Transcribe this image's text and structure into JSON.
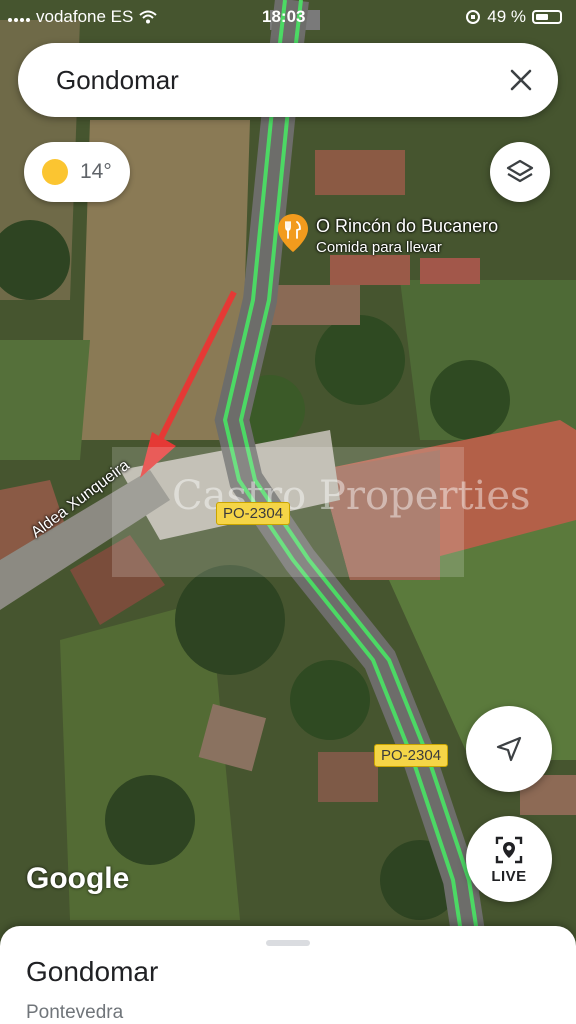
{
  "status_bar": {
    "carrier": "vodafone ES",
    "time": "18:03",
    "battery": "49 %"
  },
  "search": {
    "query": "Gondomar",
    "clear_icon": "close-icon"
  },
  "weather": {
    "temperature": "14°",
    "icon": "sun-icon"
  },
  "map": {
    "place": {
      "name": "O Rincón do Bucanero",
      "category": "Comida para llevar",
      "icon": "restaurant-pin-icon"
    },
    "road_shields": [
      "PO-2304",
      "PO-2304"
    ],
    "street_name": "Aldea Xunqueira",
    "watermark": "Castro Properties",
    "attribution": "Google",
    "route_color": "#4cd964",
    "arrow_color": "#e53935"
  },
  "controls": {
    "layers_icon": "layers-icon",
    "locate_icon": "navigation-arrow-icon",
    "live_label": "LIVE"
  },
  "bottom_sheet": {
    "title": "Gondomar",
    "subtitle": "Pontevedra"
  }
}
